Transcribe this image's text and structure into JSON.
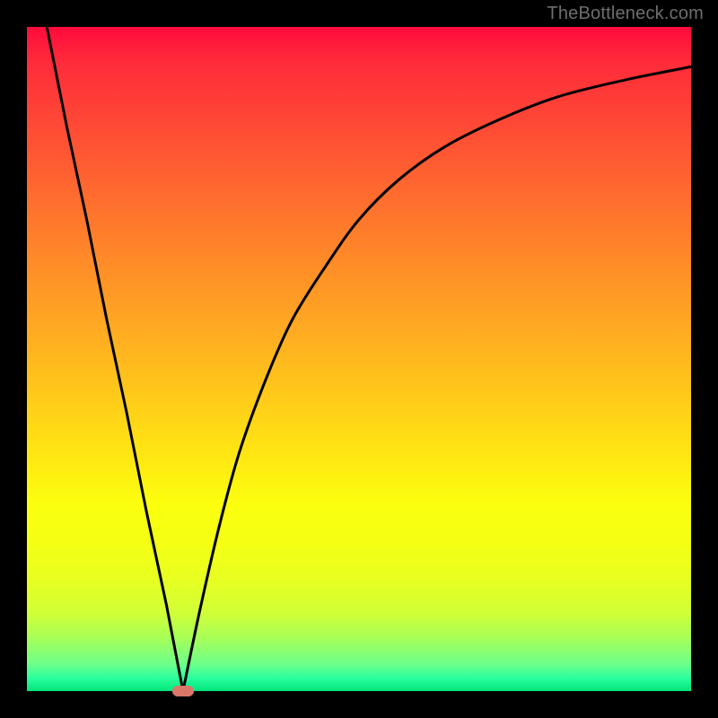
{
  "watermark": "TheBottleneck.com",
  "colors": {
    "background": "#000000",
    "gradient_top": "#ff0a3c",
    "gradient_bottom": "#00e57a",
    "curve": "#000000",
    "marker": "#d9776a"
  },
  "chart_data": {
    "type": "line",
    "title": "",
    "xlabel": "",
    "ylabel": "",
    "xlim": [
      0,
      100
    ],
    "ylim": [
      0,
      100
    ],
    "legend": null,
    "annotations": [],
    "series": [
      {
        "name": "left-branch",
        "x": [
          3,
          6,
          9,
          12,
          15,
          18,
          21,
          23.5
        ],
        "values": [
          100,
          85,
          71,
          56,
          42,
          27,
          13,
          0
        ]
      },
      {
        "name": "right-branch",
        "x": [
          23.5,
          26,
          29,
          32,
          36,
          40,
          45,
          50,
          56,
          63,
          71,
          80,
          90,
          100
        ],
        "values": [
          0,
          12,
          25,
          36,
          47,
          56,
          64,
          71,
          77,
          82,
          86,
          89.5,
          92,
          94
        ]
      }
    ],
    "marker": {
      "x": 23.5,
      "y": 0,
      "label": ""
    }
  }
}
